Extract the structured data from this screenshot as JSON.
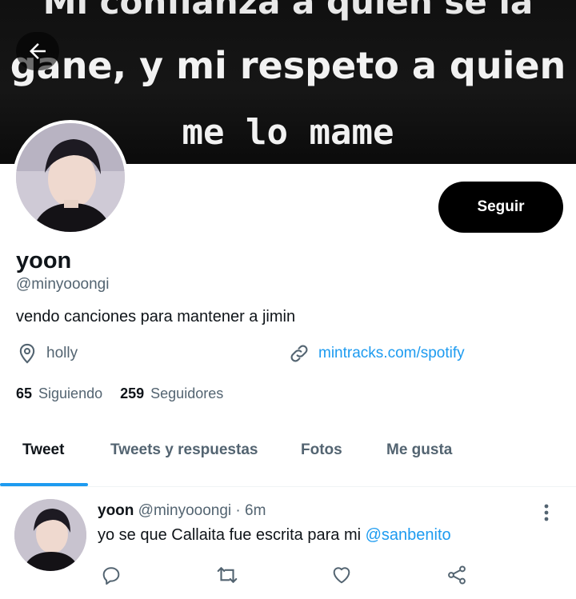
{
  "banner": {
    "line1": "Mi confianza a quien se la",
    "line2": "gane, y mi respeto a quien",
    "line3": "me lo mame"
  },
  "icons": {
    "back": "arrow-left-icon",
    "location": "location-pin-icon",
    "link": "link-icon",
    "more": "more-vertical-icon",
    "reply": "reply-icon",
    "retweet": "retweet-icon",
    "like": "heart-icon",
    "share": "share-icon"
  },
  "colors": {
    "accent": "#1d9bf0",
    "text": "#0f1419",
    "muted": "#536471",
    "button": "#000000"
  },
  "profile": {
    "name": "yoon",
    "handle": "@minyooongi",
    "bio": "vendo canciones para mantener a jimin",
    "location": "holly",
    "link": "mintracks.com/spotify",
    "follow_label": "Seguir",
    "following_count": "65",
    "following_label": "Siguiendo",
    "followers_count": "259",
    "followers_label": "Seguidores"
  },
  "tabs": [
    {
      "label": "Tweet",
      "active": true
    },
    {
      "label": "Tweets y respuestas",
      "active": false
    },
    {
      "label": "Fotos",
      "active": false
    },
    {
      "label": "Me gusta",
      "active": false
    }
  ],
  "tweet": {
    "name": "yoon",
    "handle": "@minyooongi",
    "separator": "·",
    "time": "6m",
    "text": "yo se que Callaita fue escrita para mi",
    "mention": "@sanbenito"
  }
}
